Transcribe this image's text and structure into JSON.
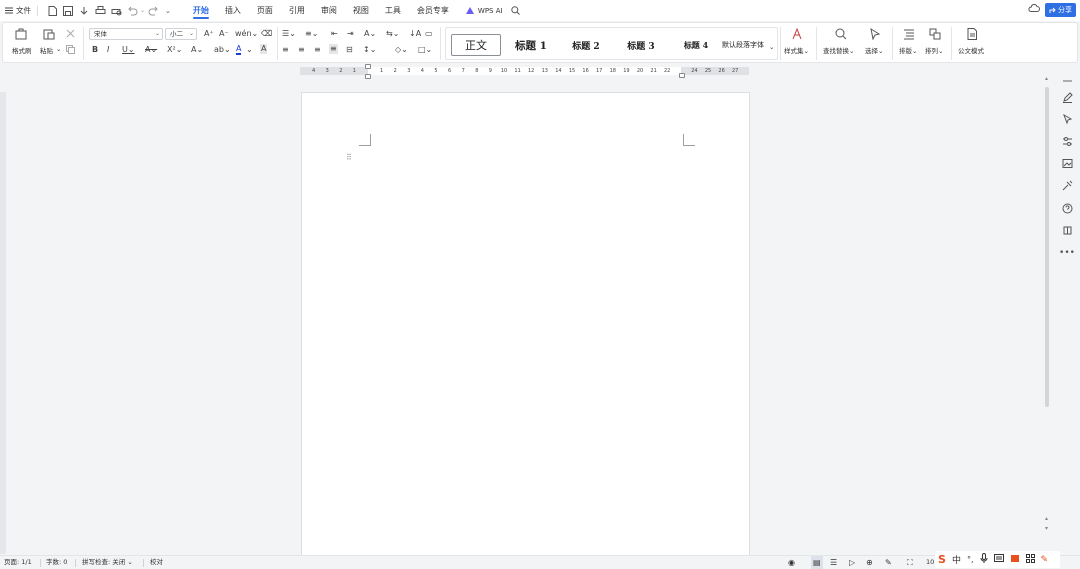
{
  "menubar": {
    "file_label": "文件",
    "tabs": [
      {
        "label": "开始",
        "active": true
      },
      {
        "label": "插入"
      },
      {
        "label": "页面"
      },
      {
        "label": "引用"
      },
      {
        "label": "审阅"
      },
      {
        "label": "视图"
      },
      {
        "label": "工具"
      },
      {
        "label": "会员专享"
      }
    ],
    "wps_ai_label": "WPS AI",
    "share_label": "分享",
    "accent_color": "#2f6fe4"
  },
  "ribbon": {
    "format_painter_label": "格式刷",
    "paste_label": "粘贴",
    "font_name": "宋体",
    "font_size": "小二",
    "styles": [
      "正文",
      "标题 1",
      "标题 2",
      "标题 3",
      "标题 4",
      "默认段落字体"
    ],
    "style_set_label": "样式集",
    "find_replace_label": "查找替换",
    "select_label": "选择",
    "layout_label": "排版",
    "arrange_label": "排列",
    "official_doc_label": "公文模式"
  },
  "ruler": {
    "left_marks": [
      "4",
      "3",
      "2",
      "1"
    ],
    "marks": [
      "1",
      "2",
      "3",
      "4",
      "5",
      "6",
      "7",
      "8",
      "9",
      "10",
      "11",
      "12",
      "13",
      "14",
      "15",
      "16",
      "17",
      "18",
      "19",
      "20",
      "21",
      "22"
    ],
    "right_marks": [
      "24",
      "25",
      "26",
      "27"
    ]
  },
  "statusbar": {
    "page": "页面: 1/1",
    "word_count": "字数: 0",
    "spell_check": "拼写检查: 关闭",
    "proofread": "校对",
    "zoom": "10"
  },
  "ime": {
    "lang": "中"
  }
}
